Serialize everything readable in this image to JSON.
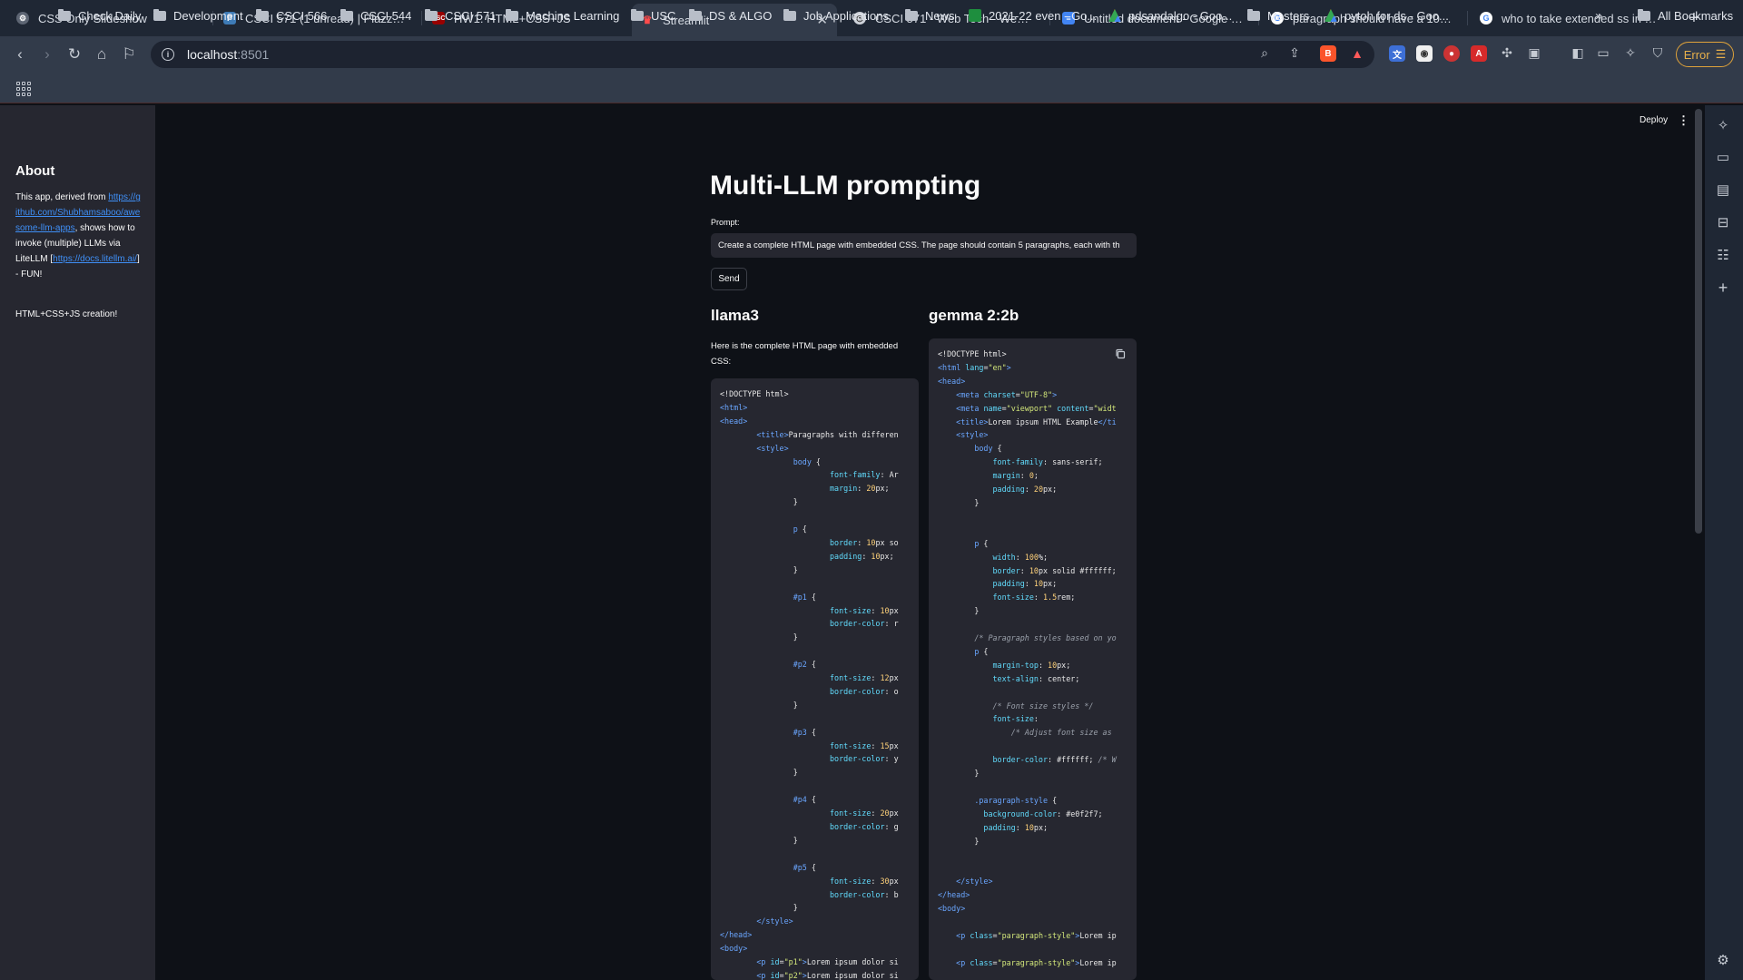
{
  "browser": {
    "tabs": [
      {
        "title": "CSS Only Slideshow",
        "favicon": "gear-icon",
        "favicon_color": "#8a93a3"
      },
      {
        "title": "CSCI 571 (1 unread) | Piazza QA",
        "favicon": "piazza-icon",
        "favicon_color": "#3e7bb6"
      },
      {
        "title": "HW1: HTML+CSS+JS",
        "favicon": "usc-icon",
        "favicon_color": "#990000"
      },
      {
        "title": "Streamlit",
        "favicon": "streamlit-icon",
        "favicon_color": "#ff4b4b",
        "active": true
      },
      {
        "title": "CSCI 571 - Web Tech - Web pag",
        "favicon": "chrome-icon",
        "favicon_color": "#cfd3da"
      },
      {
        "title": "Untitled document - Google Doc",
        "favicon": "docs-icon",
        "favicon_color": "#4285f4"
      },
      {
        "title": "paragraph should have a 10px s",
        "favicon": "google-icon",
        "favicon_color": "#ffffff"
      },
      {
        "title": "who to take extended ss in mac",
        "favicon": "google-icon",
        "favicon_color": "#ffffff"
      }
    ],
    "url_host": "localhost",
    "url_port": ":8501",
    "error_label": "Error",
    "bookmarks": [
      {
        "label": "Check Daily",
        "type": "folder"
      },
      {
        "label": "Development",
        "type": "folder"
      },
      {
        "label": "CSCI 566",
        "type": "folder"
      },
      {
        "label": "CSCI 544",
        "type": "folder"
      },
      {
        "label": "CSCI 571",
        "type": "folder"
      },
      {
        "label": "Machine Learning",
        "type": "folder"
      },
      {
        "label": "USC",
        "type": "folder"
      },
      {
        "label": "DS & ALGO",
        "type": "folder"
      },
      {
        "label": "Job Applications",
        "type": "folder"
      },
      {
        "label": "News",
        "type": "folder"
      },
      {
        "label": "2021-22 even - Go...",
        "type": "sheets"
      },
      {
        "label": "pdsandalgo - Goo...",
        "type": "drive"
      },
      {
        "label": "Masters",
        "type": "folder"
      },
      {
        "label": "pytoh for ds - Goo...",
        "type": "drive"
      }
    ],
    "all_bookmarks": "All Bookmarks"
  },
  "sidebar": {
    "title": "About",
    "text_before": "This app, derived from ",
    "link1": "https://github.com/Shubhamsaboo/awesome-llm-apps",
    "text_mid": ", shows how to invoke (multiple) LLMs via LiteLLM [",
    "link2": "https://docs.litellm.ai/",
    "text_after": "] - FUN!",
    "extra": "HTML+CSS+JS creation!"
  },
  "header": {
    "deploy_label": "Deploy"
  },
  "main": {
    "title": "Multi-LLM prompting",
    "prompt_label": "Prompt:",
    "prompt_value": "Create a complete HTML page with embedded CSS.  The page should contain 5 paragraphs, each with th",
    "send_label": "Send",
    "col1_title": "llama3",
    "col1_intro": "Here is the complete HTML page with embedded CSS:",
    "col2_title": "gemma 2:2b",
    "llama_code": [
      [
        [
          "t",
          "<!DOCTYPE html>"
        ]
      ],
      [
        [
          "g",
          "<html>"
        ]
      ],
      [
        [
          "g",
          "<head>"
        ]
      ],
      [
        [
          "s",
          "        "
        ],
        [
          "g",
          "<title>"
        ],
        [
          "t",
          "Paragraphs with differen"
        ]
      ],
      [
        [
          "s",
          "        "
        ],
        [
          "g",
          "<style>"
        ]
      ],
      [
        [
          "s",
          "                "
        ],
        [
          "c",
          "body"
        ],
        [
          "t",
          " {"
        ]
      ],
      [
        [
          "s",
          "                        "
        ],
        [
          "p",
          "font-family"
        ],
        [
          "t",
          ": Ar"
        ]
      ],
      [
        [
          "s",
          "                        "
        ],
        [
          "p",
          "margin"
        ],
        [
          "t",
          ": "
        ],
        [
          "v",
          "20"
        ],
        [
          "t",
          "px;"
        ]
      ],
      [
        [
          "s",
          "                "
        ],
        [
          "t",
          "}"
        ]
      ],
      [
        [
          "t",
          ""
        ]
      ],
      [
        [
          "s",
          "                "
        ],
        [
          "c",
          "p"
        ],
        [
          "t",
          " {"
        ]
      ],
      [
        [
          "s",
          "                        "
        ],
        [
          "p",
          "border"
        ],
        [
          "t",
          ": "
        ],
        [
          "v",
          "10"
        ],
        [
          "t",
          "px so"
        ]
      ],
      [
        [
          "s",
          "                        "
        ],
        [
          "p",
          "padding"
        ],
        [
          "t",
          ": "
        ],
        [
          "v",
          "10"
        ],
        [
          "t",
          "px;"
        ]
      ],
      [
        [
          "s",
          "                "
        ],
        [
          "t",
          "}"
        ]
      ],
      [
        [
          "t",
          ""
        ]
      ],
      [
        [
          "s",
          "                "
        ],
        [
          "c",
          "#p1"
        ],
        [
          "t",
          " {"
        ]
      ],
      [
        [
          "s",
          "                        "
        ],
        [
          "p",
          "font-size"
        ],
        [
          "t",
          ": "
        ],
        [
          "v",
          "10"
        ],
        [
          "t",
          "px"
        ]
      ],
      [
        [
          "s",
          "                        "
        ],
        [
          "p",
          "border-color"
        ],
        [
          "t",
          ": r"
        ]
      ],
      [
        [
          "s",
          "                "
        ],
        [
          "t",
          "}"
        ]
      ],
      [
        [
          "t",
          ""
        ]
      ],
      [
        [
          "s",
          "                "
        ],
        [
          "c",
          "#p2"
        ],
        [
          "t",
          " {"
        ]
      ],
      [
        [
          "s",
          "                        "
        ],
        [
          "p",
          "font-size"
        ],
        [
          "t",
          ": "
        ],
        [
          "v",
          "12"
        ],
        [
          "t",
          "px"
        ]
      ],
      [
        [
          "s",
          "                        "
        ],
        [
          "p",
          "border-color"
        ],
        [
          "t",
          ": o"
        ]
      ],
      [
        [
          "s",
          "                "
        ],
        [
          "t",
          "}"
        ]
      ],
      [
        [
          "t",
          ""
        ]
      ],
      [
        [
          "s",
          "                "
        ],
        [
          "c",
          "#p3"
        ],
        [
          "t",
          " {"
        ]
      ],
      [
        [
          "s",
          "                        "
        ],
        [
          "p",
          "font-size"
        ],
        [
          "t",
          ": "
        ],
        [
          "v",
          "15"
        ],
        [
          "t",
          "px"
        ]
      ],
      [
        [
          "s",
          "                        "
        ],
        [
          "p",
          "border-color"
        ],
        [
          "t",
          ": y"
        ]
      ],
      [
        [
          "s",
          "                "
        ],
        [
          "t",
          "}"
        ]
      ],
      [
        [
          "t",
          ""
        ]
      ],
      [
        [
          "s",
          "                "
        ],
        [
          "c",
          "#p4"
        ],
        [
          "t",
          " {"
        ]
      ],
      [
        [
          "s",
          "                        "
        ],
        [
          "p",
          "font-size"
        ],
        [
          "t",
          ": "
        ],
        [
          "v",
          "20"
        ],
        [
          "t",
          "px"
        ]
      ],
      [
        [
          "s",
          "                        "
        ],
        [
          "p",
          "border-color"
        ],
        [
          "t",
          ": g"
        ]
      ],
      [
        [
          "s",
          "                "
        ],
        [
          "t",
          "}"
        ]
      ],
      [
        [
          "t",
          ""
        ]
      ],
      [
        [
          "s",
          "                "
        ],
        [
          "c",
          "#p5"
        ],
        [
          "t",
          " {"
        ]
      ],
      [
        [
          "s",
          "                        "
        ],
        [
          "p",
          "font-size"
        ],
        [
          "t",
          ": "
        ],
        [
          "v",
          "30"
        ],
        [
          "t",
          "px"
        ]
      ],
      [
        [
          "s",
          "                        "
        ],
        [
          "p",
          "border-color"
        ],
        [
          "t",
          ": b"
        ]
      ],
      [
        [
          "s",
          "                "
        ],
        [
          "t",
          "}"
        ]
      ],
      [
        [
          "s",
          "        "
        ],
        [
          "g",
          "</style>"
        ]
      ],
      [
        [
          "g",
          "</head>"
        ]
      ],
      [
        [
          "g",
          "<body>"
        ]
      ],
      [
        [
          "s",
          "        "
        ],
        [
          "g",
          "<p "
        ],
        [
          "p",
          "id"
        ],
        [
          "t",
          "="
        ],
        [
          "r",
          "\"p1\""
        ],
        [
          "g",
          ">"
        ],
        [
          "t",
          "Lorem ipsum dolor si"
        ]
      ],
      [
        [
          "s",
          "        "
        ],
        [
          "g",
          "<p "
        ],
        [
          "p",
          "id"
        ],
        [
          "t",
          "="
        ],
        [
          "r",
          "\"p2\""
        ],
        [
          "g",
          ">"
        ],
        [
          "t",
          "Lorem ipsum dolor si"
        ]
      ]
    ],
    "gemma_code": [
      [
        [
          "t",
          "<!DOCTYPE html>"
        ]
      ],
      [
        [
          "g",
          "<html "
        ],
        [
          "p",
          "lang"
        ],
        [
          "t",
          "="
        ],
        [
          "r",
          "\"en\""
        ],
        [
          "g",
          ">"
        ]
      ],
      [
        [
          "g",
          "<head>"
        ]
      ],
      [
        [
          "s",
          "    "
        ],
        [
          "g",
          "<meta "
        ],
        [
          "p",
          "charset"
        ],
        [
          "t",
          "="
        ],
        [
          "r",
          "\"UTF-8\""
        ],
        [
          "g",
          ">"
        ]
      ],
      [
        [
          "s",
          "    "
        ],
        [
          "g",
          "<meta "
        ],
        [
          "p",
          "name"
        ],
        [
          "t",
          "="
        ],
        [
          "r",
          "\"viewport\""
        ],
        [
          "t",
          " "
        ],
        [
          "p",
          "content"
        ],
        [
          "t",
          "="
        ],
        [
          "r",
          "\"widt"
        ]
      ],
      [
        [
          "s",
          "    "
        ],
        [
          "g",
          "<title>"
        ],
        [
          "t",
          "Lorem ipsum HTML Example"
        ],
        [
          "g",
          "</ti"
        ]
      ],
      [
        [
          "s",
          "    "
        ],
        [
          "g",
          "<style>"
        ]
      ],
      [
        [
          "s",
          "        "
        ],
        [
          "c",
          "body"
        ],
        [
          "t",
          " {"
        ]
      ],
      [
        [
          "s",
          "            "
        ],
        [
          "p",
          "font-family"
        ],
        [
          "t",
          ": sans-serif;"
        ]
      ],
      [
        [
          "s",
          "            "
        ],
        [
          "p",
          "margin"
        ],
        [
          "t",
          ": "
        ],
        [
          "v",
          "0"
        ],
        [
          "t",
          ";"
        ]
      ],
      [
        [
          "s",
          "            "
        ],
        [
          "p",
          "padding"
        ],
        [
          "t",
          ": "
        ],
        [
          "v",
          "20"
        ],
        [
          "t",
          "px;"
        ]
      ],
      [
        [
          "s",
          "        "
        ],
        [
          "t",
          "}"
        ]
      ],
      [
        [
          "t",
          ""
        ]
      ],
      [
        [
          "t",
          ""
        ]
      ],
      [
        [
          "s",
          "        "
        ],
        [
          "c",
          "p"
        ],
        [
          "t",
          " {"
        ]
      ],
      [
        [
          "s",
          "            "
        ],
        [
          "p",
          "width"
        ],
        [
          "t",
          ": "
        ],
        [
          "v",
          "100"
        ],
        [
          "t",
          "%;"
        ]
      ],
      [
        [
          "s",
          "            "
        ],
        [
          "p",
          "border"
        ],
        [
          "t",
          ": "
        ],
        [
          "v",
          "10"
        ],
        [
          "t",
          "px solid #ffffff;"
        ]
      ],
      [
        [
          "s",
          "            "
        ],
        [
          "p",
          "padding"
        ],
        [
          "t",
          ": "
        ],
        [
          "v",
          "10"
        ],
        [
          "t",
          "px;"
        ]
      ],
      [
        [
          "s",
          "            "
        ],
        [
          "p",
          "font-size"
        ],
        [
          "t",
          ": "
        ],
        [
          "v",
          "1.5"
        ],
        [
          "t",
          "rem;"
        ]
      ],
      [
        [
          "s",
          "        "
        ],
        [
          "t",
          "}"
        ]
      ],
      [
        [
          "t",
          ""
        ]
      ],
      [
        [
          "s",
          "        "
        ],
        [
          "m",
          "/* Paragraph styles based on yo"
        ]
      ],
      [
        [
          "s",
          "        "
        ],
        [
          "c",
          "p"
        ],
        [
          "t",
          " {"
        ]
      ],
      [
        [
          "s",
          "            "
        ],
        [
          "p",
          "margin-top"
        ],
        [
          "t",
          ": "
        ],
        [
          "v",
          "10"
        ],
        [
          "t",
          "px;"
        ]
      ],
      [
        [
          "s",
          "            "
        ],
        [
          "p",
          "text-align"
        ],
        [
          "t",
          ": center;"
        ]
      ],
      [
        [
          "t",
          ""
        ]
      ],
      [
        [
          "s",
          "            "
        ],
        [
          "m",
          "/* Font size styles */"
        ]
      ],
      [
        [
          "s",
          "            "
        ],
        [
          "p",
          "font-size"
        ],
        [
          "t",
          ":"
        ]
      ],
      [
        [
          "s",
          "                "
        ],
        [
          "m",
          "/* Adjust font size as"
        ]
      ],
      [
        [
          "t",
          ""
        ]
      ],
      [
        [
          "s",
          "            "
        ],
        [
          "p",
          "border-color"
        ],
        [
          "t",
          ": #ffffff; "
        ],
        [
          "m",
          "/* W"
        ]
      ],
      [
        [
          "s",
          "        "
        ],
        [
          "t",
          "}"
        ]
      ],
      [
        [
          "t",
          ""
        ]
      ],
      [
        [
          "s",
          "        "
        ],
        [
          "c",
          ".paragraph-style"
        ],
        [
          "t",
          " {"
        ]
      ],
      [
        [
          "s",
          "          "
        ],
        [
          "p",
          "background-color"
        ],
        [
          "t",
          ": #e0f2f7;"
        ]
      ],
      [
        [
          "s",
          "          "
        ],
        [
          "p",
          "padding"
        ],
        [
          "t",
          ": "
        ],
        [
          "v",
          "10"
        ],
        [
          "t",
          "px;"
        ]
      ],
      [
        [
          "s",
          "        "
        ],
        [
          "t",
          "}"
        ]
      ],
      [
        [
          "t",
          ""
        ]
      ],
      [
        [
          "t",
          ""
        ]
      ],
      [
        [
          "s",
          "    "
        ],
        [
          "g",
          "</style>"
        ]
      ],
      [
        [
          "g",
          "</head>"
        ]
      ],
      [
        [
          "g",
          "<body>"
        ]
      ],
      [
        [
          "t",
          ""
        ]
      ],
      [
        [
          "s",
          "    "
        ],
        [
          "g",
          "<p "
        ],
        [
          "p",
          "class"
        ],
        [
          "t",
          "="
        ],
        [
          "r",
          "\"paragraph-style\""
        ],
        [
          "g",
          ">"
        ],
        [
          "t",
          "Lorem ip"
        ]
      ],
      [
        [
          "t",
          ""
        ]
      ],
      [
        [
          "s",
          "    "
        ],
        [
          "g",
          "<p "
        ],
        [
          "p",
          "class"
        ],
        [
          "t",
          "="
        ],
        [
          "r",
          "\"paragraph-style\""
        ],
        [
          "g",
          ">"
        ],
        [
          "t",
          "Lorem ip"
        ]
      ],
      [
        [
          "t",
          ""
        ]
      ],
      [
        [
          "s",
          "    "
        ],
        [
          "g",
          "<p "
        ],
        [
          "p",
          "class"
        ],
        [
          "t",
          "="
        ],
        [
          "r",
          "\"paragraph-style\""
        ],
        [
          "g",
          ">"
        ],
        [
          "t",
          "Lorem ip"
        ]
      ]
    ]
  }
}
